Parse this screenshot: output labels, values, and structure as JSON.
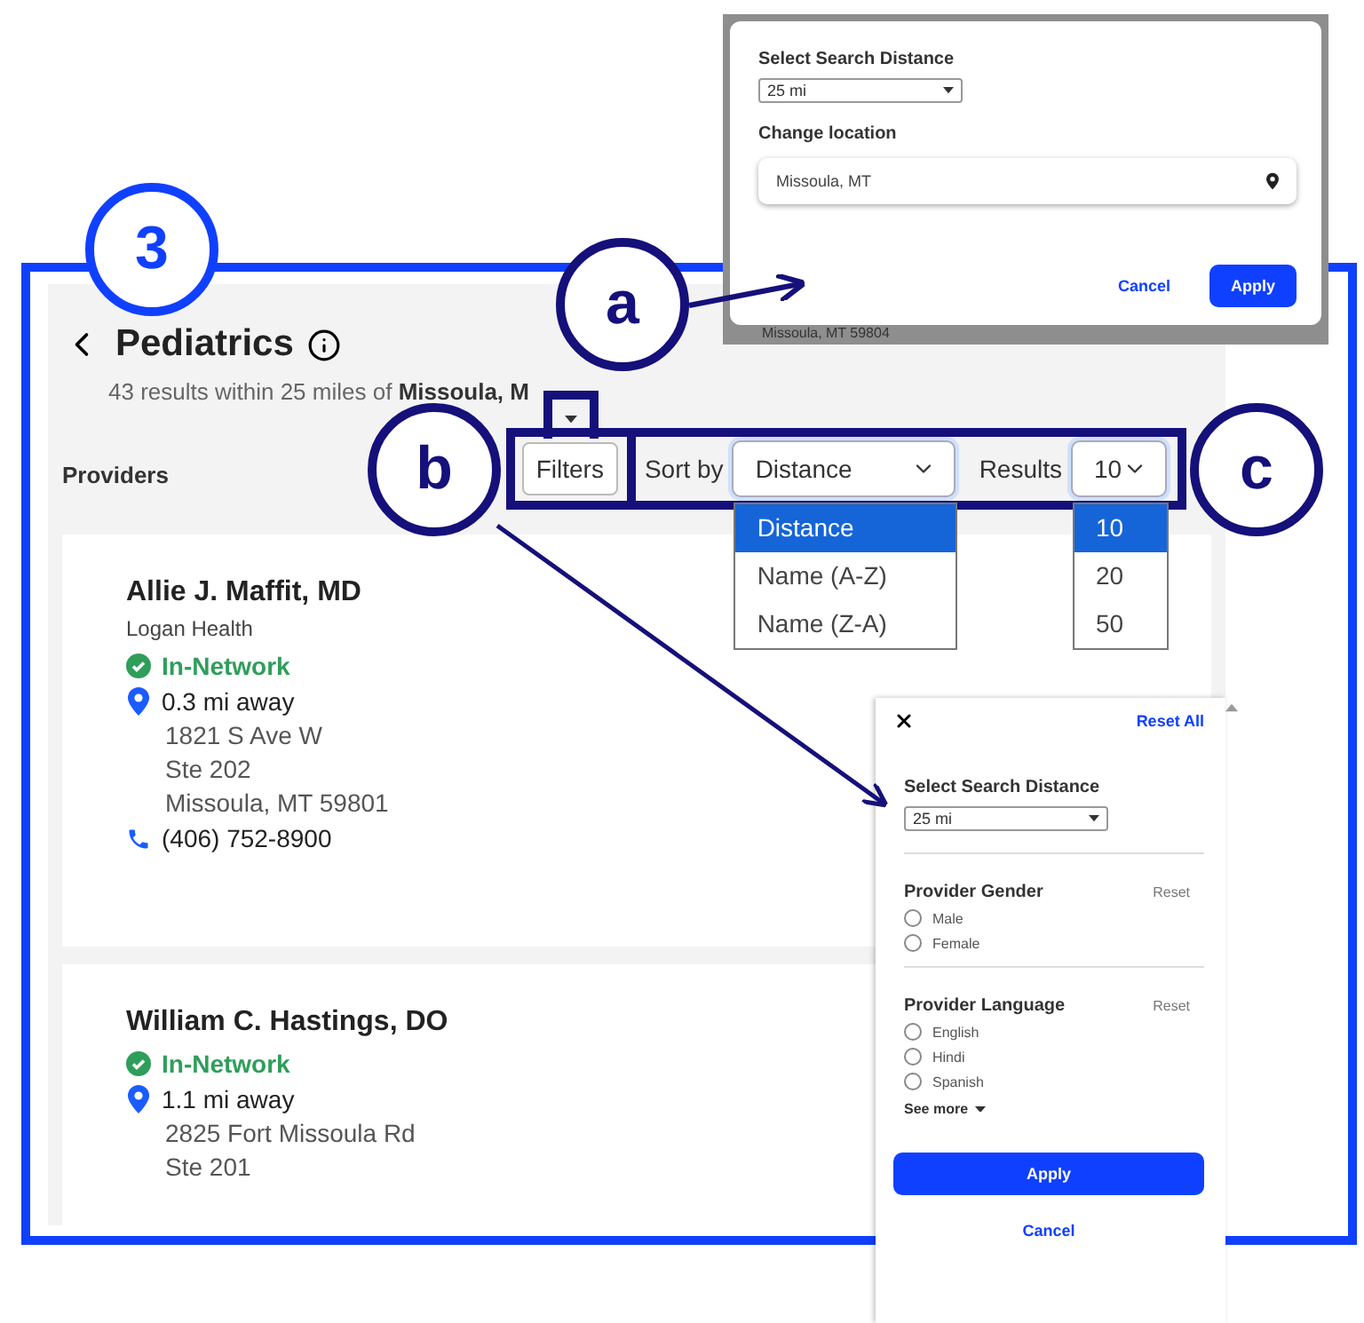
{
  "badge": {
    "number": "3"
  },
  "callouts": [
    {
      "label": "a"
    },
    {
      "label": "b"
    },
    {
      "label": "c"
    }
  ],
  "page": {
    "title": "Pediatrics",
    "summary": "43 results within 25 miles of",
    "location": "Missoula, M",
    "providers_label": "Providers",
    "filters_button": "Filters",
    "sort_label": "Sort by",
    "sort_value": "Distance",
    "results_label": "Results",
    "results_value": "10",
    "sort_options": [
      {
        "label": "Distance",
        "selected": true
      },
      {
        "label": "Name (A-Z)",
        "selected": false
      },
      {
        "label": "Name (Z-A)",
        "selected": false
      }
    ],
    "results_options": [
      {
        "label": "10",
        "selected": true
      },
      {
        "label": "20",
        "selected": false
      },
      {
        "label": "50",
        "selected": false
      }
    ],
    "providers": [
      {
        "name": "Allie J. Maffit, MD",
        "organization": "Logan Health",
        "network": "In-Network",
        "distance": "0.3 mi away",
        "address": [
          "1821 S Ave W",
          "Ste 202",
          "Missoula, MT 59801"
        ],
        "phone": "(406) 752-8900"
      },
      {
        "name": "William C. Hastings, DO",
        "network": "In-Network",
        "distance": "1.1 mi away",
        "address": [
          "2825 Fort Missoula Rd",
          "Ste 201"
        ]
      }
    ]
  },
  "location_dialog": {
    "distance_label": "Select Search Distance",
    "distance_value": "25 mi",
    "location_label": "Change location",
    "location_value": "Missoula, MT",
    "cancel": "Cancel",
    "apply": "Apply",
    "backdrop_text": "Missoula, MT 59804"
  },
  "filter_panel": {
    "reset_all": "Reset All",
    "distance_label": "Select Search Distance",
    "distance_value": "25 mi",
    "sections": [
      {
        "title": "Provider Gender",
        "reset": "Reset",
        "options": [
          {
            "label": "Male",
            "checked": false
          },
          {
            "label": "Female",
            "checked": false
          }
        ]
      },
      {
        "title": "Provider Language",
        "reset": "Reset",
        "options": [
          {
            "label": "English",
            "checked": false
          },
          {
            "label": "Hindi",
            "checked": false
          },
          {
            "label": "Spanish",
            "checked": false
          }
        ],
        "see_more": "See more"
      }
    ],
    "apply": "Apply",
    "cancel": "Cancel"
  }
}
